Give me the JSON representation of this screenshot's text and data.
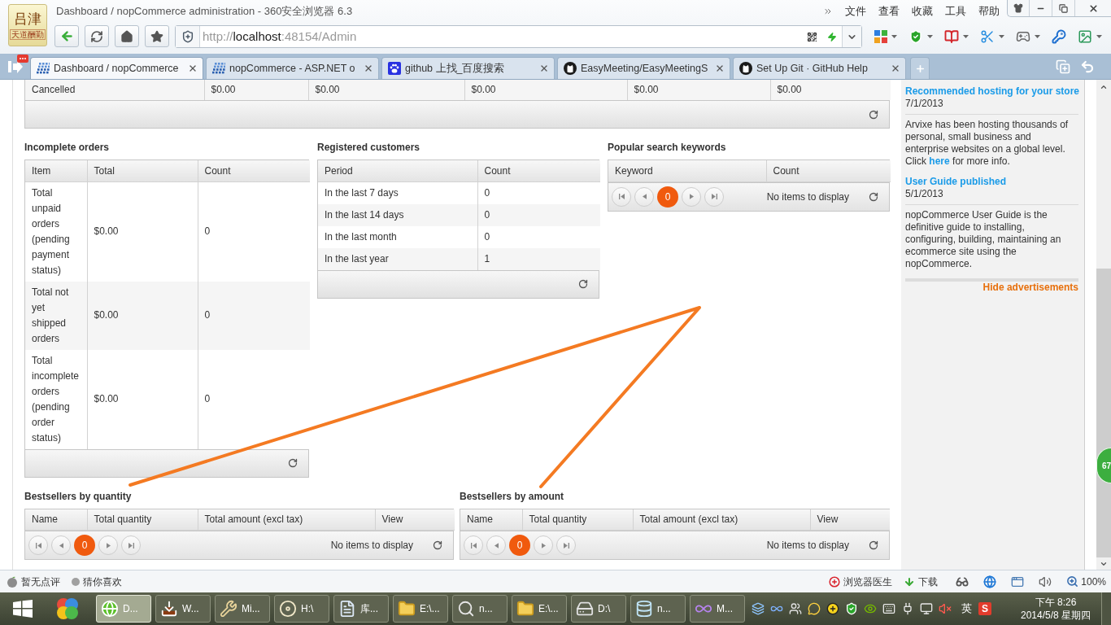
{
  "browser": {
    "logo": {
      "name": "吕津",
      "motto": "天道酬勤"
    },
    "title": "Dashboard / nopCommerce administration - 360安全浏览器 6.3",
    "menu": [
      "文件",
      "查看",
      "收藏",
      "工具",
      "帮助"
    ],
    "address": {
      "scheme": "http://",
      "host": "localhost",
      "path": ":48154/Admin"
    }
  },
  "tabs": [
    {
      "label": "Dashboard / nopCommerce",
      "kind": "grid",
      "selected": true
    },
    {
      "label": "nopCommerce - ASP.NET o",
      "kind": "grid",
      "selected": false
    },
    {
      "label": "github 上找_百度搜索",
      "kind": "paw",
      "selected": false
    },
    {
      "label": "EasyMeeting/EasyMeetingS",
      "kind": "cat",
      "selected": false
    },
    {
      "label": "Set Up Git · GitHub Help",
      "kind": "cat",
      "selected": false
    }
  ],
  "orders_summary": {
    "rows": [
      [
        "Cancelled",
        "$0.00",
        "$0.00",
        "$0.00",
        "$0.00",
        "$0.00"
      ]
    ]
  },
  "incomplete_orders": {
    "title": "Incomplete orders",
    "columns": [
      "Item",
      "Total",
      "Count"
    ],
    "rows": [
      [
        "Total unpaid orders (pending payment status)",
        "$0.00",
        "0"
      ],
      [
        "Total not yet shipped orders",
        "$0.00",
        "0"
      ],
      [
        "Total incomplete orders (pending order status)",
        "$0.00",
        "0"
      ]
    ]
  },
  "registered_customers": {
    "title": "Registered customers",
    "columns": [
      "Period",
      "Count"
    ],
    "rows": [
      [
        "In the last 7 days",
        "0"
      ],
      [
        "In the last 14 days",
        "0"
      ],
      [
        "In the last month",
        "0"
      ],
      [
        "In the last year",
        "1"
      ]
    ]
  },
  "popular_search_keywords": {
    "title": "Popular search keywords",
    "columns": [
      "Keyword",
      "Count"
    ],
    "pager": {
      "page": "0",
      "message": "No items to display"
    }
  },
  "bestsellers": [
    {
      "title": "Bestsellers by quantity",
      "columns": [
        "Name",
        "Total quantity",
        "Total amount (excl tax)",
        "View"
      ],
      "pager": {
        "page": "0",
        "message": "No items to display"
      }
    },
    {
      "title": "Bestsellers by amount",
      "columns": [
        "Name",
        "Total quantity",
        "Total amount (excl tax)",
        "View"
      ],
      "pager": {
        "page": "0",
        "message": "No items to display"
      }
    }
  ],
  "sidebar": {
    "news": [
      {
        "title": "Recommended hosting for your store",
        "date": "7/1/2013",
        "text": "Arvixe has been hosting thousands of personal, small business and enterprise websites on a global level. Click",
        "link": "here",
        "text_after": "for more info."
      },
      {
        "title": "User Guide published",
        "date": "5/1/2013",
        "text": "nopCommerce User Guide is the definitive guide to installing, configuring, building, maintaining an ecommerce site using the nopCommerce."
      }
    ],
    "hide_link": "Hide advertisements"
  },
  "speed_ball": {
    "label": "67"
  },
  "status_bar": {
    "left": [
      {
        "label": "暂无点评",
        "kind": "fruit"
      },
      {
        "label": "猜你喜欢",
        "kind": "dot"
      }
    ],
    "right": [
      {
        "label": "浏览器医生",
        "kind": "cross"
      },
      {
        "label": "下载",
        "kind": "download"
      }
    ],
    "zoom": "100%"
  },
  "taskbar": {
    "items": [
      {
        "label": "D...",
        "kind": "browser",
        "selected": true
      },
      {
        "label": "W...",
        "kind": "download",
        "selected": false
      },
      {
        "label": "Mi...",
        "kind": "tools",
        "selected": false
      },
      {
        "label": "H:\\",
        "kind": "disc",
        "selected": false
      },
      {
        "label": "库...",
        "kind": "library",
        "selected": false
      },
      {
        "label": "E:\\...",
        "kind": "folder",
        "selected": false
      },
      {
        "label": "n...",
        "kind": "search",
        "selected": false
      },
      {
        "label": "E:\\...",
        "kind": "folder",
        "selected": false
      },
      {
        "label": "D:\\",
        "kind": "drive",
        "selected": false
      },
      {
        "label": "n...",
        "kind": "database",
        "selected": false
      },
      {
        "label": "M...",
        "kind": "infinity",
        "selected": false
      }
    ],
    "ime": "英",
    "ime_logo": "S",
    "time": "下午 8:26",
    "date": "2014/5/8 星期四"
  }
}
